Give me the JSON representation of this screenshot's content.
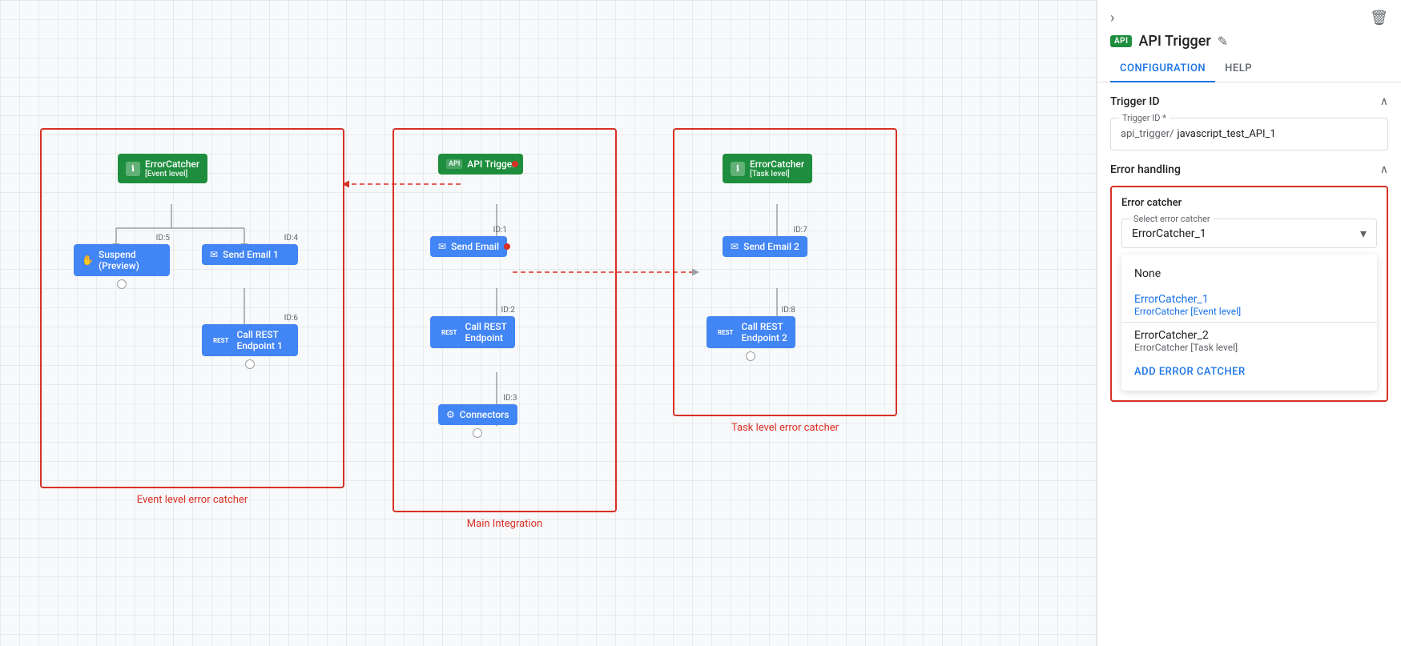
{
  "panel": {
    "chevron_label": "›",
    "delete_icon": "🗑",
    "api_badge": "API",
    "title": "API Trigger",
    "edit_icon": "✎",
    "tabs": [
      {
        "id": "configuration",
        "label": "CONFIGURATION",
        "active": true
      },
      {
        "id": "help",
        "label": "HELP",
        "active": false
      }
    ],
    "trigger_id_section": {
      "title": "Trigger ID",
      "field_label": "Trigger ID *",
      "prefix": "api_trigger/",
      "value": "javascript_test_API_1"
    },
    "error_handling_section": {
      "title": "Error handling",
      "error_catcher_label": "Error catcher",
      "select_label": "Select error catcher",
      "selected_value": "ErrorCatcher_1",
      "dropdown_items": [
        {
          "label": "None",
          "sub_label": "",
          "type": "none"
        },
        {
          "label": "ErrorCatcher_1",
          "sub_label": "ErrorCatcher [Event level]",
          "type": "selected"
        },
        {
          "label": "ErrorCatcher_2",
          "sub_label": "ErrorCatcher [Task level]",
          "type": "normal"
        }
      ],
      "add_button_label": "ADD ERROR CATCHER"
    }
  },
  "canvas": {
    "boxes": [
      {
        "id": "event-level",
        "label": "Event level error catcher"
      },
      {
        "id": "main-integration",
        "label": "Main Integration"
      },
      {
        "id": "task-level",
        "label": "Task level error catcher"
      }
    ],
    "nodes": {
      "event_level": {
        "error_catcher": {
          "label": "ErrorCatcher",
          "sub": "[Event level]"
        },
        "suspend": {
          "label": "Suspend\n(Preview)",
          "id": "ID:5"
        },
        "send_email_1": {
          "label": "Send Email 1",
          "id": "ID:4"
        },
        "call_rest_1": {
          "label": "Call REST\nEndpoint 1",
          "id": "ID:6"
        }
      },
      "main": {
        "api_trigger": {
          "label": "API Trigger"
        },
        "send_email": {
          "label": "Send Email",
          "id": "ID:1"
        },
        "call_rest": {
          "label": "Call REST\nEndpoint",
          "id": "ID:2"
        },
        "connectors": {
          "label": "Connectors",
          "id": "ID:3"
        }
      },
      "task_level": {
        "error_catcher": {
          "label": "ErrorCatcher",
          "sub": "[Task level]"
        },
        "send_email_2": {
          "label": "Send Email 2",
          "id": "ID:7"
        },
        "call_rest_2": {
          "label": "Call REST\nEndpoint 2",
          "id": "ID:8"
        }
      }
    }
  }
}
